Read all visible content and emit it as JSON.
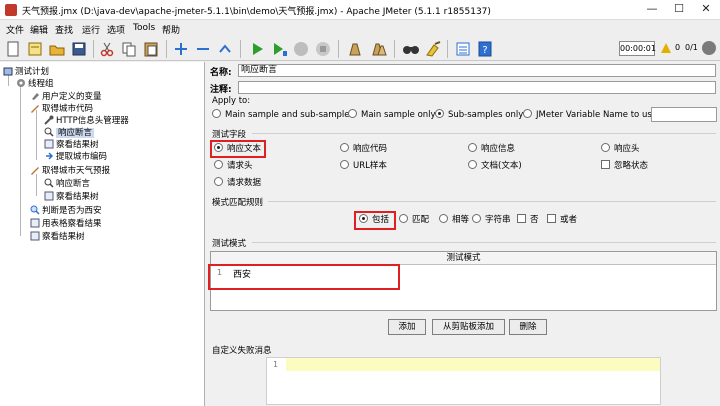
{
  "window": {
    "title": "天气预报.jmx (D:\\java-dev\\apache-jmeter-5.1.1\\bin\\demo\\天气预报.jmx) - Apache JMeter (5.1.1 r1855137)",
    "minimize_glyph": "—",
    "maximize_glyph": "☐",
    "close_glyph": "✕"
  },
  "menu": [
    "文件",
    "编辑",
    "查找",
    "运行",
    "选项",
    "Tools",
    "帮助"
  ],
  "toolbar": {
    "icons": [
      "new-file-icon",
      "templates-icon",
      "open-icon",
      "save-icon",
      "cut-icon",
      "copy-icon",
      "paste-icon",
      "expand-icon",
      "collapse-icon",
      "toggle-icon",
      "start-icon",
      "start-no-pause-icon",
      "stop-icon",
      "shutdown-icon",
      "clear-icon",
      "clear-all-icon",
      "search-icon",
      "reset-search-icon",
      "function-helper-icon",
      "help-icon"
    ],
    "timer": "00:00:01",
    "error_count": "0",
    "threads": "0/1"
  },
  "tree": [
    {
      "label": "测试计划",
      "icon": "test-plan-icon",
      "level": 0
    },
    {
      "label": "线程组",
      "icon": "gear-icon",
      "level": 1
    },
    {
      "label": "用户定义的变量",
      "icon": "config-icon",
      "level": 2
    },
    {
      "label": "取得城市代码",
      "icon": "pen-icon",
      "level": 2
    },
    {
      "label": "HTTP信息头管理器",
      "icon": "wrench-icon",
      "level": 3
    },
    {
      "label": "响应断言",
      "icon": "assertion-icon",
      "level": 3,
      "selected": true
    },
    {
      "label": "察看结果树",
      "icon": "listener-icon",
      "level": 3
    },
    {
      "label": "提取城市编码",
      "icon": "extractor-icon",
      "level": 3
    },
    {
      "label": "取得城市天气预报",
      "icon": "pen-icon",
      "level": 2
    },
    {
      "label": "响应断言",
      "icon": "assertion-icon",
      "level": 3
    },
    {
      "label": "察看结果树",
      "icon": "listener-icon",
      "level": 3
    },
    {
      "label": "判断是否为西安",
      "icon": "magnifier-icon",
      "level": 2
    },
    {
      "label": "用表格察看结果",
      "icon": "listener-icon",
      "level": 2
    },
    {
      "label": "察看结果树",
      "icon": "listener-icon",
      "level": 2
    }
  ],
  "form": {
    "name_label": "名称:",
    "name_value": "响应断言",
    "comment_label": "注释:",
    "comment_value": "",
    "apply_to": {
      "title": "Apply to:",
      "options": [
        "Main sample and sub-samples",
        "Main sample only",
        "Sub-samples only",
        "JMeter Variable Name to use"
      ],
      "selected": 2,
      "variable_value": ""
    },
    "test_field": {
      "title": "测试字段",
      "options": [
        "响应文本",
        "响应代码",
        "响应信息",
        "响应头",
        "请求头",
        "URL样本",
        "文档(文本)",
        "忽略状态",
        "请求数据"
      ],
      "selected": "响应文本"
    },
    "pattern_rules": {
      "title": "模式匹配规则",
      "options": [
        "包括",
        "匹配",
        "相等",
        "字符串",
        "否",
        "或者"
      ],
      "selected": "包括"
    },
    "test_patterns": {
      "title": "测试模式",
      "column_header": "测试模式",
      "rows": [
        {
          "line": "1",
          "value": "西安"
        }
      ]
    },
    "buttons": [
      "添加",
      "从剪贴板添加",
      "删除"
    ],
    "custom_failure": {
      "title": "自定义失败消息",
      "line": "1",
      "value": ""
    }
  }
}
